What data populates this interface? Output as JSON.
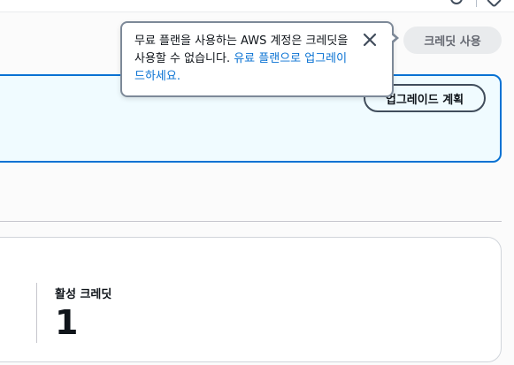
{
  "header": {
    "credit_button_label": "크레딧 사용"
  },
  "popover": {
    "message": "무료 플랜을 사용하는 AWS 계정은 크레딧을 사용할 수 없습니다.",
    "link_text": "유료 플랜으로 업그레이드하세요."
  },
  "banner": {
    "upgrade_button_label": "업그레이드 계획"
  },
  "credits": {
    "active_label": "활성 크레딧",
    "active_value": "1"
  }
}
